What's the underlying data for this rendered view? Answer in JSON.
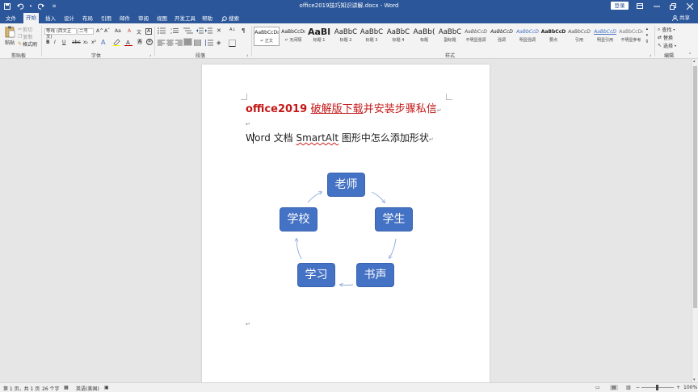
{
  "window": {
    "title": "office2019技巧知识讲解.docx - Word",
    "signin_label": "登录"
  },
  "tabs": [
    "文件",
    "开始",
    "插入",
    "设计",
    "布局",
    "引用",
    "邮件",
    "审阅",
    "视图",
    "开发工具",
    "帮助"
  ],
  "search_label": "搜索",
  "share_label": "共享",
  "ribbon": {
    "clipboard": {
      "group": "剪贴板",
      "paste": "粘贴",
      "cut": "剪切",
      "copy": "复制",
      "format_painter": "格式刷"
    },
    "font": {
      "group": "字体",
      "font_name": "等线 (西文正文)",
      "font_size": "二号",
      "bold": "B",
      "italic": "I",
      "underline": "U",
      "strike": "abc",
      "subscript": "x₂",
      "superscript": "x²",
      "grow": "A^",
      "shrink": "Aˇ",
      "case": "Aa",
      "clear": "A",
      "phonetic": "文",
      "border_char": "A"
    },
    "paragraph": {
      "group": "段落"
    },
    "styles": {
      "group": "样式",
      "items": [
        {
          "sample": "AaBbCcDı",
          "name": "↵ 正文"
        },
        {
          "sample": "AaBbCcDı",
          "name": "↵ 无间隔"
        },
        {
          "sample": "AaBl",
          "name": "标题 1"
        },
        {
          "sample": "AaBbC",
          "name": "标题 2"
        },
        {
          "sample": "AaBbC",
          "name": "标题 3"
        },
        {
          "sample": "AaBbC",
          "name": "标题 4"
        },
        {
          "sample": "AaBb(",
          "name": "标题"
        },
        {
          "sample": "AaBbC",
          "name": "副标题"
        },
        {
          "sample": "AaBbCcD",
          "name": "不明显强调"
        },
        {
          "sample": "AaBbCcD",
          "name": "强调"
        },
        {
          "sample": "AaBbCcD",
          "name": "明显强调"
        },
        {
          "sample": "AaBbCcD",
          "name": "要点"
        },
        {
          "sample": "AaBbCcD",
          "name": "引用"
        },
        {
          "sample": "AaBbCcD",
          "name": "明显引用"
        },
        {
          "sample": "AaBbCcDı",
          "name": "不明显参考"
        }
      ]
    },
    "editing": {
      "group": "编辑",
      "find": "查找",
      "replace": "替换",
      "select": "选择"
    }
  },
  "document": {
    "heading1_plain": "office2019 ",
    "heading1_link": "破解版下载",
    "heading1_rest": "并安装步骤私信",
    "heading2_a": "Word 文档 ",
    "heading2_b": "SmartAlt",
    "heading2_c": " 图形中怎么添加形状",
    "smartart": {
      "nodes": [
        "老师",
        "学生",
        "书声",
        "学习",
        "学校"
      ],
      "fill": "#4472c4"
    }
  },
  "statusbar": {
    "page": "第 1 页，共 1 页",
    "words": "26 个字",
    "language": "英语(美国)",
    "zoom": "100%"
  },
  "colors": {
    "accent": "#2b579a",
    "heading_red": "#c41818"
  }
}
